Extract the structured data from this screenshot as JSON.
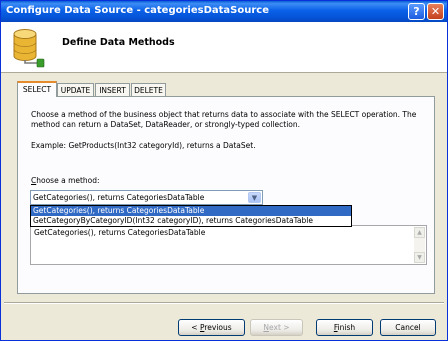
{
  "window": {
    "title": "Configure Data Source - categoriesDataSource"
  },
  "header": {
    "title": "Define Data Methods"
  },
  "tabs": [
    {
      "label": "SELECT",
      "active": true
    },
    {
      "label": "UPDATE",
      "active": false
    },
    {
      "label": "INSERT",
      "active": false
    },
    {
      "label": "DELETE",
      "active": false
    }
  ],
  "select_panel": {
    "description": "Choose a method of the business object that returns data to associate with the SELECT operation. The method can return a DataSet, DataReader, or strongly-typed collection.",
    "example": "Example: GetProducts(Int32 categoryId), returns a DataSet.",
    "method_label_accel": "C",
    "method_label_rest": "hoose a method:",
    "method_selected": "GetCategories(), returns CategoriesDataTable",
    "method_options": [
      "GetCategories(), returns CategoriesDataTable",
      "GetCategoryByCategoryID(Int32 categoryID), returns CategoriesDataTable"
    ],
    "method_signature": "GetCategories(), returns CategoriesDataTable"
  },
  "buttons": {
    "previous_pre": "< ",
    "previous_accel": "P",
    "previous_rest": "revious",
    "next_accel": "N",
    "next_rest": "ext >",
    "finish_accel": "F",
    "finish_rest": "inish",
    "cancel": "Cancel"
  },
  "colors": {
    "titlebar": "#0553d6",
    "selection": "#316ac5",
    "active_tab_accent": "#e68b2c",
    "dialog_bg": "#ece9d8"
  }
}
